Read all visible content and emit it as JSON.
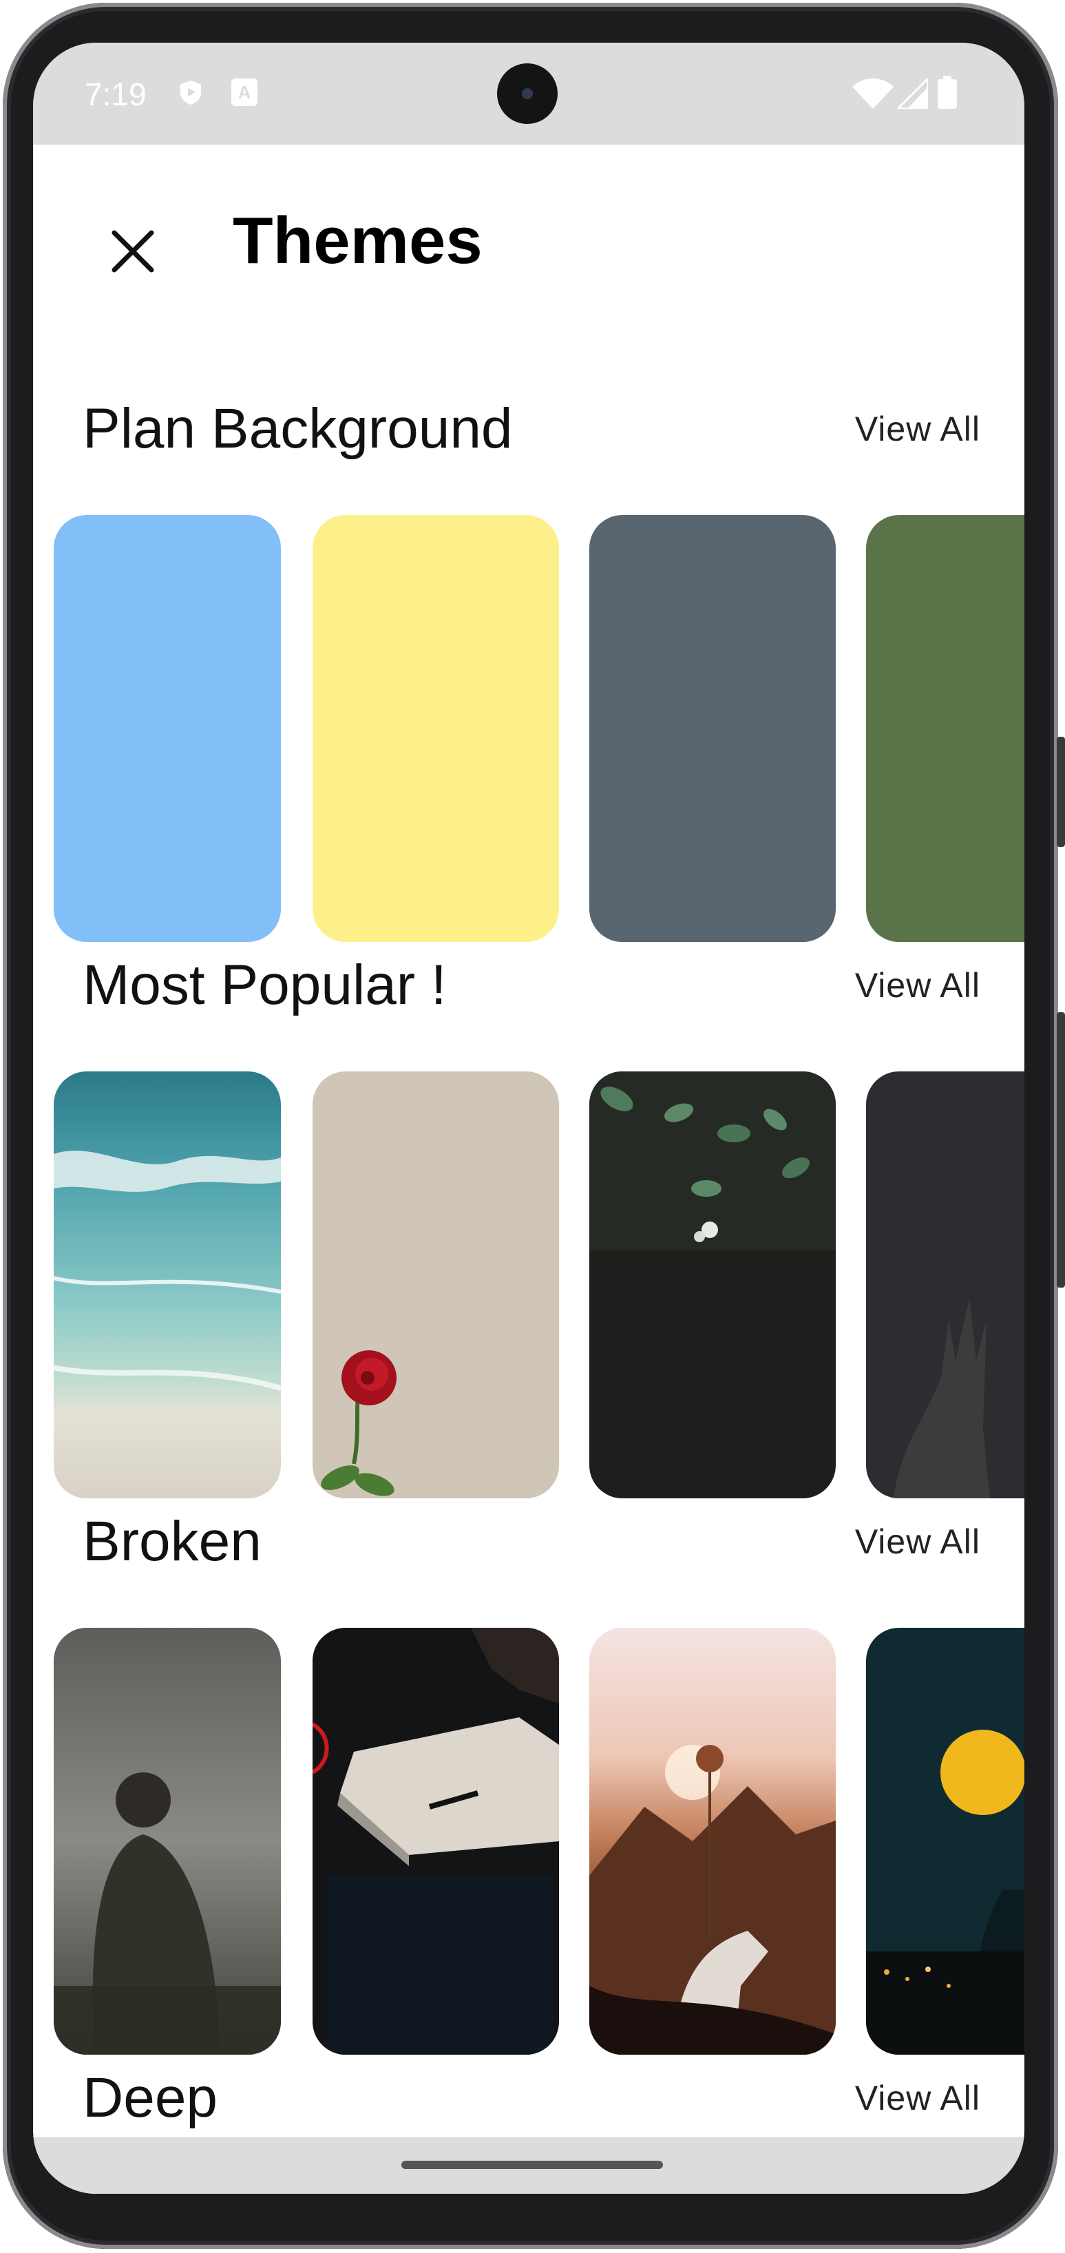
{
  "status_bar": {
    "time": "7:19"
  },
  "header": {
    "title": "Themes"
  },
  "sections": [
    {
      "title": "Plan Background",
      "view_all": "View All"
    },
    {
      "title": "Most Popular !",
      "view_all": "View All"
    },
    {
      "title": "Broken",
      "view_all": "View All"
    },
    {
      "title": "Deep",
      "view_all": "View All"
    }
  ],
  "colors": {
    "plan_backgrounds": [
      "#82bff9",
      "#fdf08a",
      "#59656f",
      "#5b7349"
    ],
    "status_bar": "#dcdcdc",
    "nav_bar": "#dcdcdc"
  },
  "icons": {
    "close": "close-icon",
    "status": [
      "shield-icon",
      "app-icon",
      "wifi-icon",
      "signal-icon",
      "battery-icon"
    ]
  }
}
